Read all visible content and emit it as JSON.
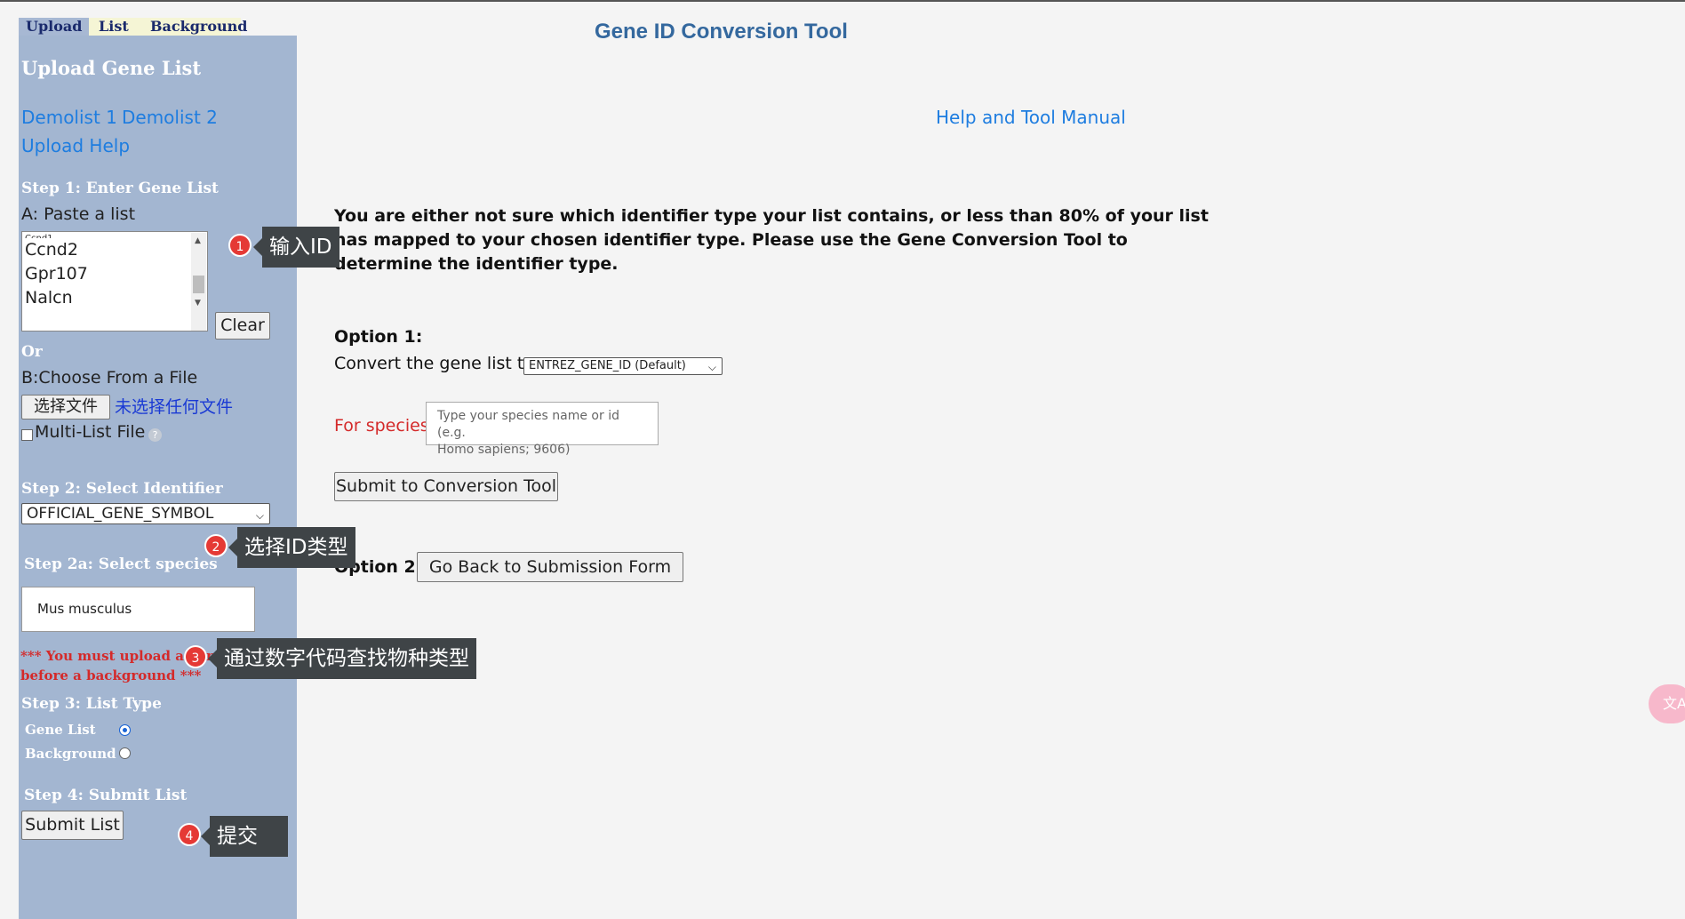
{
  "tabs": [
    "Upload",
    "List",
    "Background"
  ],
  "sidebar": {
    "title": "Upload Gene List",
    "demolist1": "Demolist 1",
    "demolist2": "Demolist 2",
    "upload_help": "Upload Help",
    "step1": "Step 1: Enter Gene List",
    "paste_label": "A: Paste a list",
    "gene_lines": [
      "Ccnd2",
      "Gpr107",
      "Nalcn"
    ],
    "clear_label": "Clear",
    "or_label": "Or",
    "choose_file_label": "B:Choose From a File",
    "file_button": "选择文件",
    "no_file_text": "未选择任何文件",
    "multilist_label": "Multi-List File",
    "step2": "Step 2: Select Identifier",
    "identifier_value": "OFFICIAL_GENE_SYMBOL",
    "step2a": "Step 2a: Select species",
    "species_value": "Mus musculus",
    "warning_line1": "*** You must upload a gene list",
    "warning_line2": "before a background ***",
    "step3": "Step 3: List Type",
    "gene_list_label": "Gene List",
    "background_label": "Background",
    "step4": "Step 4: Submit List",
    "submit_label": "Submit List"
  },
  "main": {
    "title": "Gene ID Conversion Tool",
    "manual_link": "Help and Tool Manual",
    "notice_line1": "You are either not sure which identifier type your list contains, or less than 80% of your list",
    "notice_line2": "has mapped to your chosen identifier type. Please use the Gene Conversion Tool to",
    "notice_line3": "determine the identifier type.",
    "option1_label": "Option 1:",
    "convert_label": "Convert the gene list to",
    "convert_select": "ENTREZ_GENE_ID (Default)",
    "species_label": "For species:",
    "species_placeholder_line1": "Type your species name or id (e.g.",
    "species_placeholder_line2": "Homo sapiens; 9606)",
    "submit_conversion": "Submit to Conversion Tool",
    "option2_label": "Option 2:",
    "go_back": "Go Back to Submission Form"
  },
  "annotations": [
    {
      "num": "1",
      "text": "输入ID"
    },
    {
      "num": "2",
      "text": "选择ID类型"
    },
    {
      "num": "3",
      "text": "通过数字代码查找物种类型"
    },
    {
      "num": "4",
      "text": "提交"
    }
  ],
  "colors": {
    "sidebar": "#a3b6d1",
    "title": "#34689e",
    "link": "#1e7de0",
    "warning": "#d42a2a"
  },
  "icons": {
    "translate": "translate-icon",
    "help": "help-icon"
  }
}
